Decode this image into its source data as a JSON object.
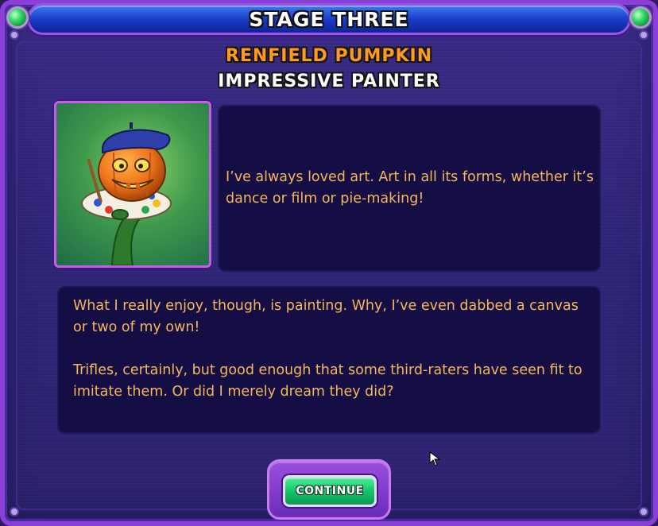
{
  "stage_title": "STAGE THREE",
  "character": {
    "name": "RENFIELD PUMPKIN",
    "title": "IMPRESSIVE PAINTER",
    "portrait_icon": "pumpkin-painter-portrait"
  },
  "dialog": {
    "intro": "I’ve always loved art. Art in all its forms, whether it’s dance or film or pie-making!",
    "paragraph_1": "What I really enjoy, though, is painting. Why, I’ve even dabbed a canvas or two of my own!",
    "paragraph_2": "Trifles, certainly, but good enough that some third-raters have seen fit to imitate them. Or did I merely dream they did?"
  },
  "buttons": {
    "continue_label": "CONTINUE"
  },
  "colors": {
    "name_orange": "#ff9a1e",
    "dialog_text": "#f6b75a",
    "panel_bg": "#140e45",
    "frame_purple": "#8a3fd6",
    "continue_green": "#14c46a"
  }
}
